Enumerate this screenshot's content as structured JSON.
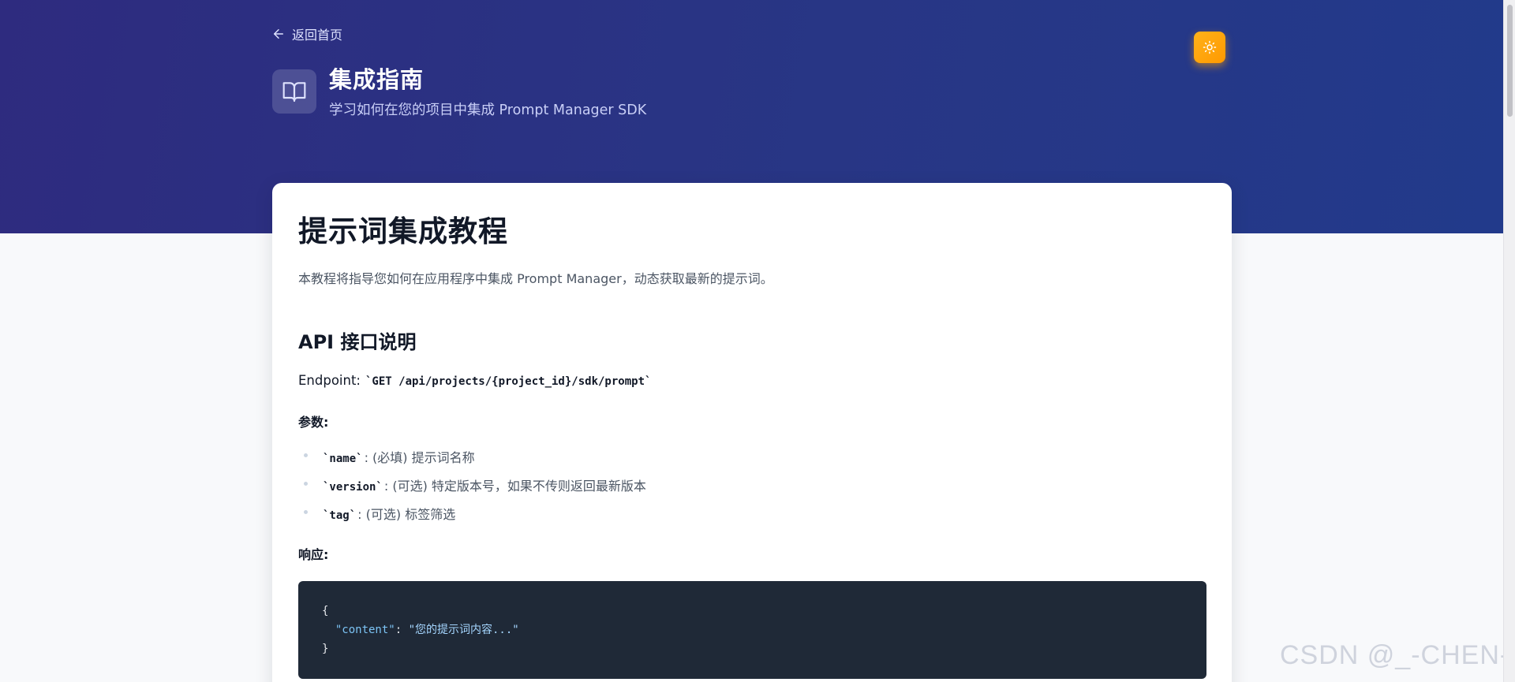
{
  "header": {
    "back_label": "返回首页",
    "title": "集成指南",
    "subtitle": "学习如何在您的项目中集成 Prompt Manager SDK"
  },
  "content": {
    "title": "提示词集成教程",
    "intro": "本教程将指导您如何在应用程序中集成 Prompt Manager，动态获取最新的提示词。",
    "api_section_title": "API 接口说明",
    "endpoint_label": "Endpoint:",
    "endpoint_value": "`GET /api/projects/{project_id}/sdk/prompt`",
    "params_label": "参数:",
    "params": [
      {
        "code": "`name`",
        "desc": ": (必填) 提示词名称"
      },
      {
        "code": "`version`",
        "desc": ": (可选) 特定版本号，如果不传则返回最新版本"
      },
      {
        "code": "`tag`",
        "desc": ": (可选) 标签筛选"
      }
    ],
    "response_label": "响应:",
    "code": {
      "open": "{",
      "key": "\"content\"",
      "colon": ": ",
      "value": "\"您的提示词内容...\"",
      "close": "}"
    }
  },
  "watermark": "CSDN @_-CHEN-_",
  "colors": {
    "hero_start": "#2e2b7f",
    "hero_end": "#223a8b",
    "toggle": "#ff9900",
    "code_bg": "#1f2937"
  },
  "icons": {
    "back": "arrow-left-icon",
    "book": "book-open-icon",
    "theme": "sun-icon"
  }
}
